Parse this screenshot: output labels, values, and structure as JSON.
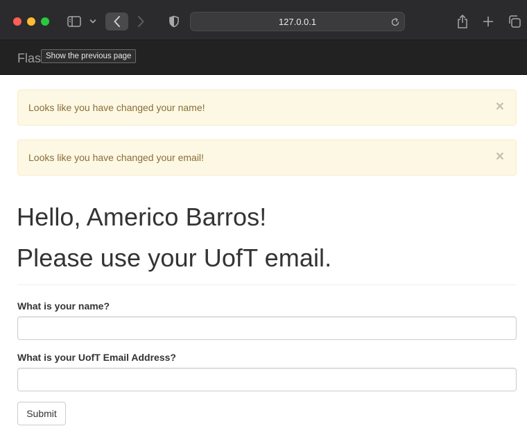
{
  "browser": {
    "url": "127.0.0.1",
    "tooltip": "Show the previous page"
  },
  "navbar": {
    "brand": "Flas"
  },
  "alerts": [
    {
      "message": "Looks like you have changed your name!",
      "close": "×"
    },
    {
      "message": "Looks like you have changed your email!",
      "close": "×"
    }
  ],
  "page": {
    "greeting": "Hello, Americo Barros!",
    "notice": "Please use your UofT email."
  },
  "form": {
    "name_label": "What is your name?",
    "name_value": "",
    "email_label": "What is your UofT Email Address?",
    "email_value": "",
    "submit_label": "Submit"
  }
}
